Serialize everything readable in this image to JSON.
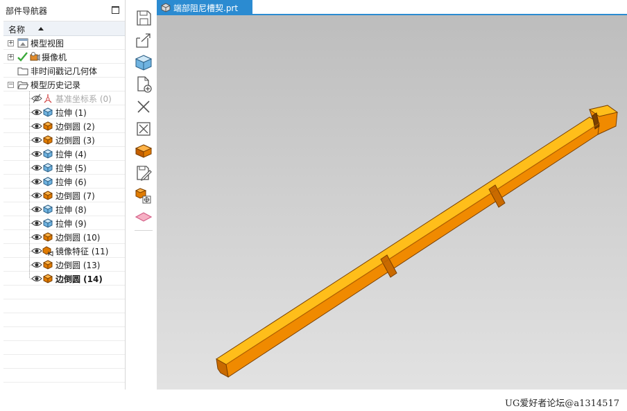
{
  "navigator": {
    "title": "部件导航器",
    "column_header": "名称",
    "nodes": [
      {
        "label": "模型视图",
        "icon": "model-views-icon",
        "expander": "+"
      },
      {
        "label": "摄像机",
        "icon": "camera-icon",
        "expander": "+",
        "checked": true
      },
      {
        "label": "非时间戳记几何体",
        "icon": "folder-icon"
      },
      {
        "label": "模型历史记录",
        "icon": "folder-open-icon",
        "expander": "-"
      }
    ],
    "features": [
      {
        "label": "基准坐标系 (0)",
        "icon": "datum-csys-icon",
        "visible": false
      },
      {
        "label": "拉伸 (1)",
        "icon": "extrude-icon",
        "visible": true
      },
      {
        "label": "边倒圆 (2)",
        "icon": "edge-blend-icon",
        "visible": true
      },
      {
        "label": "边倒圆 (3)",
        "icon": "edge-blend-icon",
        "visible": true
      },
      {
        "label": "拉伸 (4)",
        "icon": "extrude-icon",
        "visible": true
      },
      {
        "label": "拉伸 (5)",
        "icon": "extrude-icon",
        "visible": true
      },
      {
        "label": "拉伸 (6)",
        "icon": "extrude-icon",
        "visible": true
      },
      {
        "label": "边倒圆 (7)",
        "icon": "edge-blend-icon",
        "visible": true
      },
      {
        "label": "拉伸 (8)",
        "icon": "extrude-icon",
        "visible": true
      },
      {
        "label": "拉伸 (9)",
        "icon": "extrude-icon",
        "visible": true
      },
      {
        "label": "边倒圆 (10)",
        "icon": "edge-blend-icon",
        "visible": true
      },
      {
        "label": "镜像特征 (11)",
        "icon": "mirror-feature-icon",
        "visible": true
      },
      {
        "label": "边倒圆 (13)",
        "icon": "edge-blend-icon",
        "visible": true
      },
      {
        "label": "边倒圆 (14)",
        "icon": "edge-blend-icon",
        "visible": true,
        "current": true
      }
    ]
  },
  "toolbar": {
    "buttons": [
      "save-icon",
      "export-icon",
      "solid-body-icon",
      "new-file-icon",
      "close-icon",
      "close-box-icon",
      "part-icon",
      "edit-document-icon",
      "assembly-icon",
      "plane-icon"
    ]
  },
  "tab": {
    "filename": "端部阻尼槽契.prt",
    "icon": "part-file-icon",
    "accent": "#2b8bd1"
  },
  "model": {
    "color_top": "#ffbe1a",
    "color_side": "#f08a00",
    "color_end": "#c96a00"
  },
  "watermark": "UG爱好者论坛@a1314517"
}
